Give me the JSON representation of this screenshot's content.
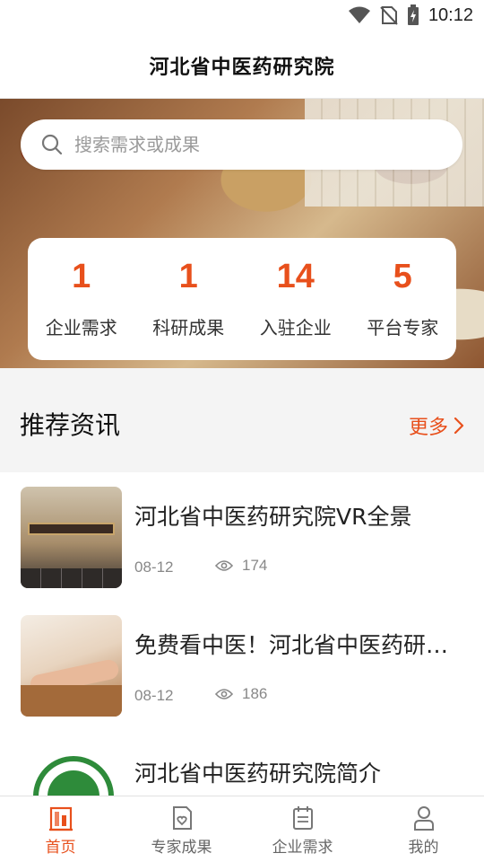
{
  "status_bar": {
    "time": "10:12"
  },
  "header": {
    "title": "河北省中医药研究院"
  },
  "search": {
    "placeholder": "搜索需求或成果"
  },
  "stats": [
    {
      "value": "1",
      "label": "企业需求"
    },
    {
      "value": "1",
      "label": "科研成果"
    },
    {
      "value": "14",
      "label": "入驻企业"
    },
    {
      "value": "5",
      "label": "平台专家"
    }
  ],
  "section": {
    "title": "推荐资讯",
    "more_label": "更多"
  },
  "news": [
    {
      "title": "河北省中医药研究院VR全景",
      "date": "08-12",
      "views": "174"
    },
    {
      "title": "免费看中医！河北省中医药研…",
      "date": "08-12",
      "views": "186"
    },
    {
      "title": "河北省中医药研究院简介"
    }
  ],
  "tabs": [
    {
      "label": "首页",
      "icon": "home-icon",
      "active": true
    },
    {
      "label": "专家成果",
      "icon": "doc-heart-icon",
      "active": false
    },
    {
      "label": "企业需求",
      "icon": "calendar-list-icon",
      "active": false
    },
    {
      "label": "我的",
      "icon": "user-icon",
      "active": false
    }
  ],
  "colors": {
    "accent": "#e8501c",
    "background": "#f4f4f4"
  }
}
